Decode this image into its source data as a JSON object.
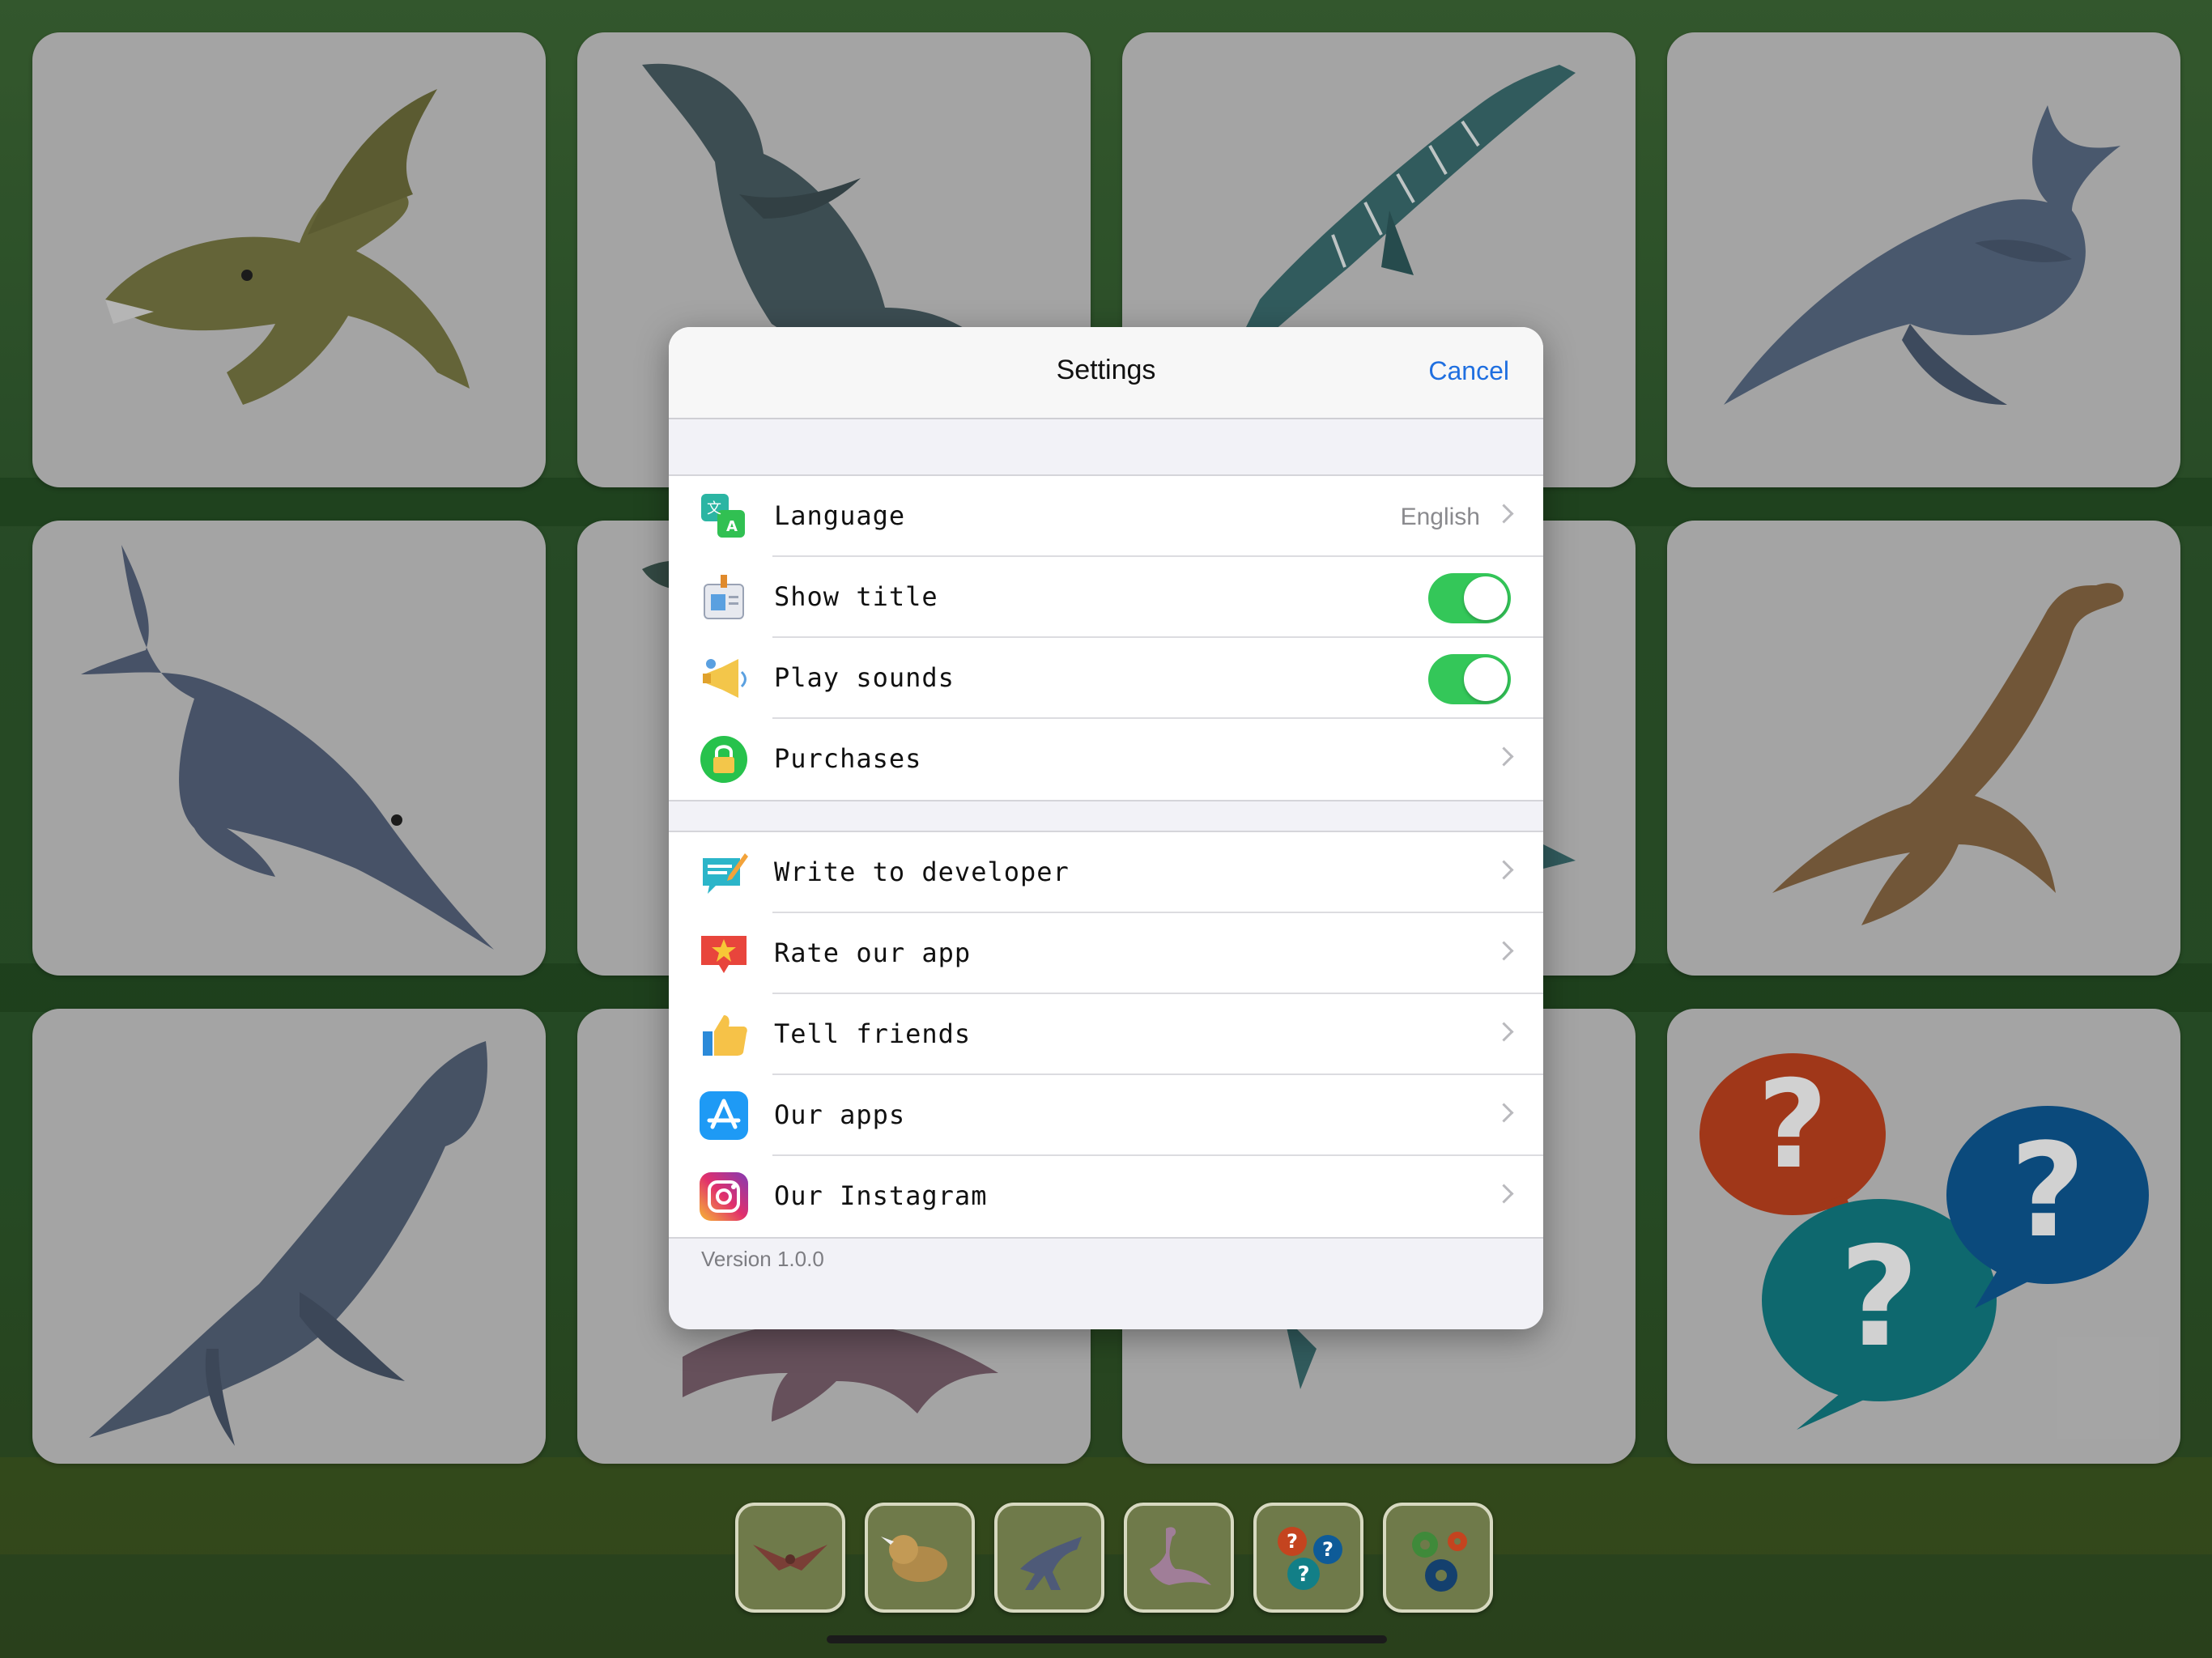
{
  "settings": {
    "title": "Settings",
    "cancel_label": "Cancel",
    "section1": [
      {
        "label": "Language",
        "value": "English",
        "icon": "translate-icon",
        "control": "chevron"
      },
      {
        "label": "Show title",
        "icon": "id-badge-icon",
        "control": "toggle",
        "on": true
      },
      {
        "label": "Play sounds",
        "icon": "megaphone-icon",
        "control": "toggle",
        "on": true
      },
      {
        "label": "Purchases",
        "icon": "lock-icon",
        "control": "chevron"
      }
    ],
    "section2": [
      {
        "label": "Write to developer",
        "icon": "compose-icon",
        "control": "chevron"
      },
      {
        "label": "Rate our app",
        "icon": "star-badge-icon",
        "control": "chevron"
      },
      {
        "label": "Tell friends",
        "icon": "thumbs-up-icon",
        "control": "chevron"
      },
      {
        "label": "Our apps",
        "icon": "app-store-icon",
        "control": "chevron"
      },
      {
        "label": "Our Instagram",
        "icon": "instagram-icon",
        "control": "chevron"
      }
    ],
    "version": "Version 1.0.0"
  },
  "cards": [
    {
      "name": "card-sea-reptile-1",
      "icon": "sea-reptile-olive"
    },
    {
      "name": "card-sea-reptile-2",
      "icon": "sea-reptile-slate"
    },
    {
      "name": "card-sea-reptile-3",
      "icon": "sea-reptile-striped-teal"
    },
    {
      "name": "card-sea-reptile-4",
      "icon": "ichthyosaur-blue"
    },
    {
      "name": "card-sea-reptile-5",
      "icon": "ichthyosaur-swordfish"
    },
    {
      "name": "card-sea-reptile-6",
      "icon": "hidden"
    },
    {
      "name": "card-sea-reptile-7",
      "icon": "hidden"
    },
    {
      "name": "card-sea-reptile-8",
      "icon": "plesiosaur-brown"
    },
    {
      "name": "card-sea-reptile-9",
      "icon": "pliosaur-blue"
    },
    {
      "name": "card-sea-reptile-10",
      "icon": "plesiosaur-purple"
    },
    {
      "name": "card-sea-reptile-11",
      "icon": "hidden"
    },
    {
      "name": "card-quiz",
      "icon": "question-bubbles"
    }
  ],
  "toolbar": [
    {
      "name": "pterosaur-category-icon"
    },
    {
      "name": "triceratops-category-icon"
    },
    {
      "name": "raptor-category-icon"
    },
    {
      "name": "sea-reptile-category-icon"
    },
    {
      "name": "quiz-icon"
    },
    {
      "name": "settings-gears-icon"
    }
  ],
  "colors": {
    "accent": "#1f6fe0",
    "toggle_on": "#34c759",
    "card_bg": "#c9c9c9"
  }
}
